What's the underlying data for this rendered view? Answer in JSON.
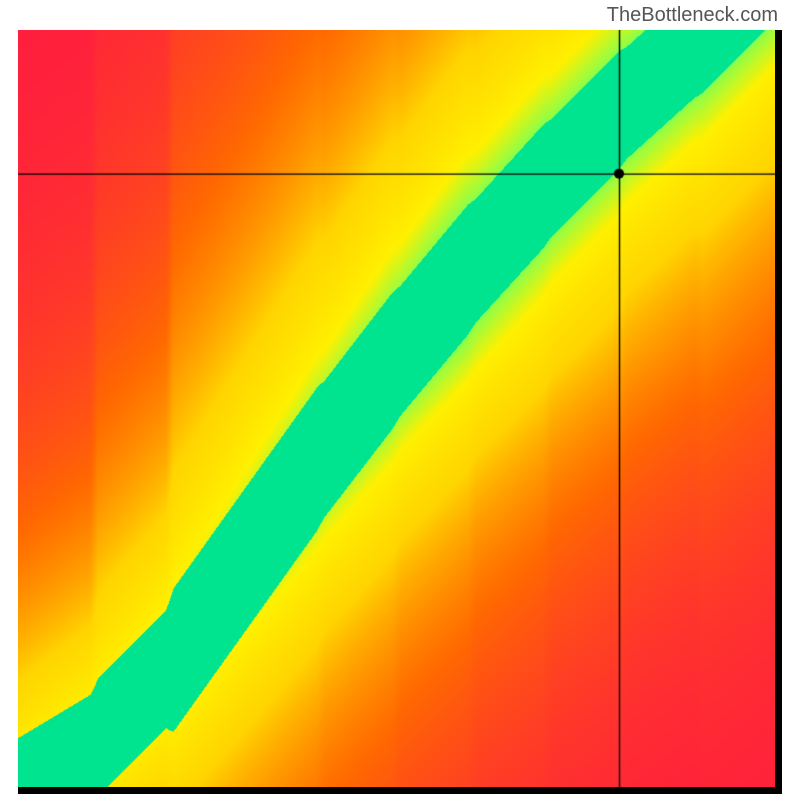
{
  "watermark": "TheBottleneck.com",
  "chart_data": {
    "type": "heatmap",
    "title": "",
    "xlabel": "",
    "ylabel": "",
    "xlim": [
      0,
      100
    ],
    "ylim": [
      0,
      100
    ],
    "crosshair": {
      "x": 79.5,
      "y": 81
    },
    "marker": {
      "x": 79.5,
      "y": 81,
      "radius": 5
    },
    "ridge": {
      "description": "Optimal balance curve (green band) running from lower-left toward upper-right with slope >1",
      "points": [
        {
          "x": 0,
          "y": 0
        },
        {
          "x": 10,
          "y": 6
        },
        {
          "x": 20,
          "y": 16
        },
        {
          "x": 30,
          "y": 30
        },
        {
          "x": 40,
          "y": 44
        },
        {
          "x": 50,
          "y": 57
        },
        {
          "x": 60,
          "y": 69
        },
        {
          "x": 70,
          "y": 80
        },
        {
          "x": 80,
          "y": 90
        },
        {
          "x": 90,
          "y": 99
        },
        {
          "x": 96,
          "y": 105
        }
      ],
      "half_width": 5.5
    },
    "colorscale": [
      {
        "t": 0.0,
        "color": "#ff1744"
      },
      {
        "t": 0.25,
        "color": "#ff6a00"
      },
      {
        "t": 0.5,
        "color": "#ffd500"
      },
      {
        "t": 0.72,
        "color": "#fff000"
      },
      {
        "t": 0.86,
        "color": "#8aff4a"
      },
      {
        "t": 1.0,
        "color": "#00e38f"
      }
    ]
  }
}
